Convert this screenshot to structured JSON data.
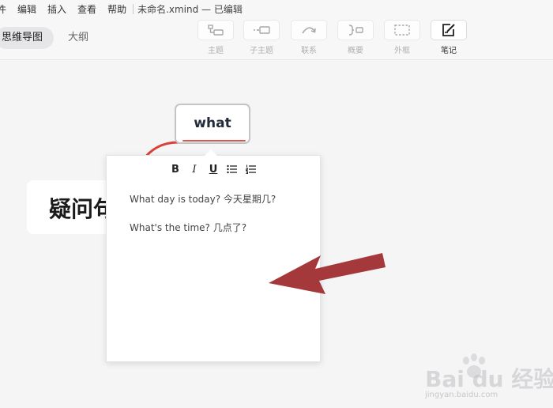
{
  "menu": {
    "items": [
      "件",
      "编辑",
      "插入",
      "查看",
      "帮助"
    ],
    "document_title": "未命名.xmind — 已编辑"
  },
  "view_tabs": {
    "mindmap": "思维导图",
    "outline": "大纲"
  },
  "toolbar": {
    "topic": "主题",
    "subtopic": "子主题",
    "relationship": "联系",
    "summary": "概要",
    "boundary": "外框",
    "note": "笔记"
  },
  "mindmap": {
    "root_topic": "疑问句",
    "subtopic": "what",
    "connector_color": "#d8423a"
  },
  "note_editor": {
    "format_buttons": [
      "B",
      "I",
      "U"
    ],
    "lines": [
      "What day is today? 今天星期几?",
      "What's the time? 几点了?"
    ]
  },
  "annotation": {
    "arrow_color": "#a4383a"
  },
  "watermark": {
    "text": "Bai du 经验",
    "subtext": "jingyan.baidu.com"
  }
}
